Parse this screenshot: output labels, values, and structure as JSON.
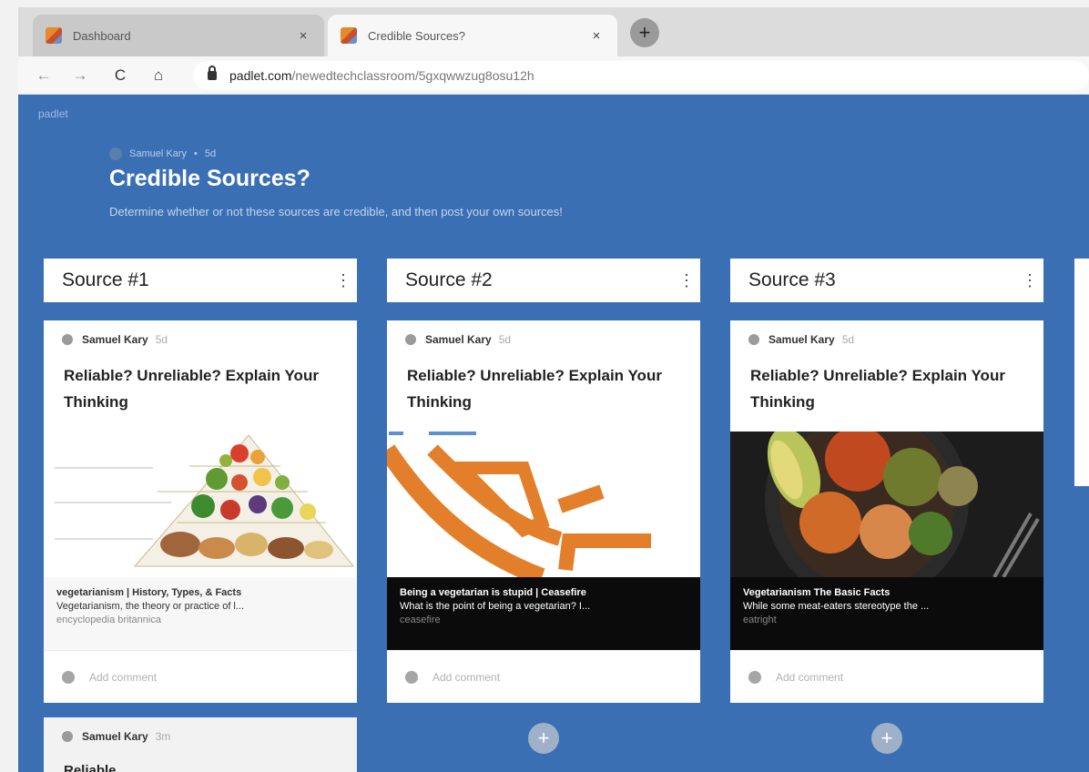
{
  "browser": {
    "tabs": [
      {
        "label": "Dashboard",
        "active": false,
        "close": "×"
      },
      {
        "label": "Credible Sources?",
        "active": true,
        "close": "×"
      }
    ],
    "new_tab": "+",
    "nav": {
      "back": "←",
      "forward": "→",
      "reload": "C",
      "home": "⌂"
    },
    "url": {
      "domain": "padlet.com",
      "path": "/newedtechclassroom/5gxqwwzug8osu12h"
    }
  },
  "board": {
    "brand": "padlet",
    "author": "Samuel Kary",
    "dot": "•",
    "age": "5d",
    "title": "Credible Sources?",
    "description": "Determine whether or not these sources are credible, and then post your own sources!",
    "background_color": "#3a6fb4"
  },
  "columns": [
    {
      "title": "Source #1",
      "menu": "⋮",
      "cards": [
        {
          "author": "Samuel Kary",
          "time": "5d",
          "title": "Reliable? Unreliable? Explain Your Thinking",
          "link": {
            "title": "vegetarianism | History, Types, & Facts",
            "description": "Vegetarianism, the theory or practice of l...",
            "source": "encyclopedia britannica",
            "style": "light"
          },
          "comment_placeholder": "Add comment"
        },
        {
          "author": "Samuel Kary",
          "time": "3m",
          "title": "Reliable"
        }
      ]
    },
    {
      "title": "Source #2",
      "menu": "⋮",
      "cards": [
        {
          "author": "Samuel Kary",
          "time": "5d",
          "title": "Reliable? Unreliable? Explain Your Thinking",
          "link": {
            "title": "Being a vegetarian is stupid | Ceasefire",
            "description": "What is the point of being a vegetarian? I...",
            "source": "ceasefire",
            "style": "dark"
          },
          "comment_placeholder": "Add comment"
        }
      ],
      "add_button": "+"
    },
    {
      "title": "Source #3",
      "menu": "⋮",
      "cards": [
        {
          "author": "Samuel Kary",
          "time": "5d",
          "title": "Reliable? Unreliable? Explain Your Thinking",
          "link": {
            "title": "Vegetarianism The Basic Facts",
            "description": "While some meat-eaters stereotype the ...",
            "source": "eatright",
            "style": "dark"
          },
          "comment_placeholder": "Add comment"
        }
      ],
      "add_button": "+"
    }
  ],
  "colors": {
    "accent_orange": "#e37f2a",
    "card_background": "#ffffff",
    "link_dark": "#0b0b0b"
  }
}
